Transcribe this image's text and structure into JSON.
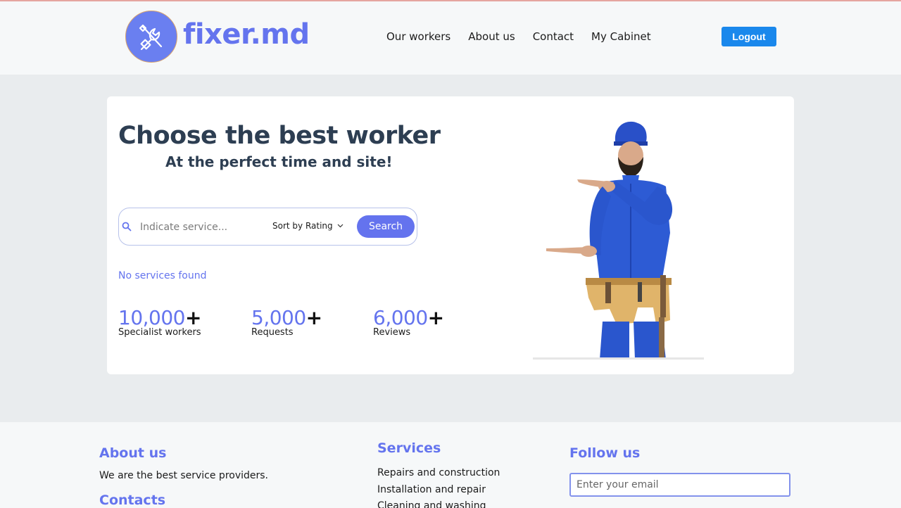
{
  "header": {
    "logo_text": "fixer.md",
    "nav": [
      "Our workers",
      "About us",
      "Contact",
      "My Cabinet"
    ],
    "logout_label": "Logout"
  },
  "hero": {
    "title": "Choose the best worker",
    "subtitle": "At the perfect time and site!",
    "search": {
      "placeholder": "Indicate service...",
      "value": "",
      "sort_label": "Sort by Rating",
      "button_label": "Search"
    },
    "no_results": "No services found",
    "stats": [
      {
        "number": "10,000",
        "plus": "+",
        "label": "Specialist workers"
      },
      {
        "number": "5,000",
        "plus": "+",
        "label": "Requests"
      },
      {
        "number": "6,000",
        "plus": "+",
        "label": "Reviews"
      }
    ]
  },
  "footer": {
    "about_title": "About us",
    "about_text": "We are the best service providers.",
    "contacts_title": "Contacts",
    "services_title": "Services",
    "services": [
      "Repairs and construction",
      "Installation and repair",
      "Cleaning and washing"
    ],
    "follow_title": "Follow us",
    "email_placeholder": "Enter your email"
  },
  "colors": {
    "brand": "#6474ee",
    "logout": "#1a88ec",
    "heading": "#2d3e52"
  },
  "icons": [
    "wrench-icon",
    "search-icon",
    "chevron-down-icon"
  ]
}
